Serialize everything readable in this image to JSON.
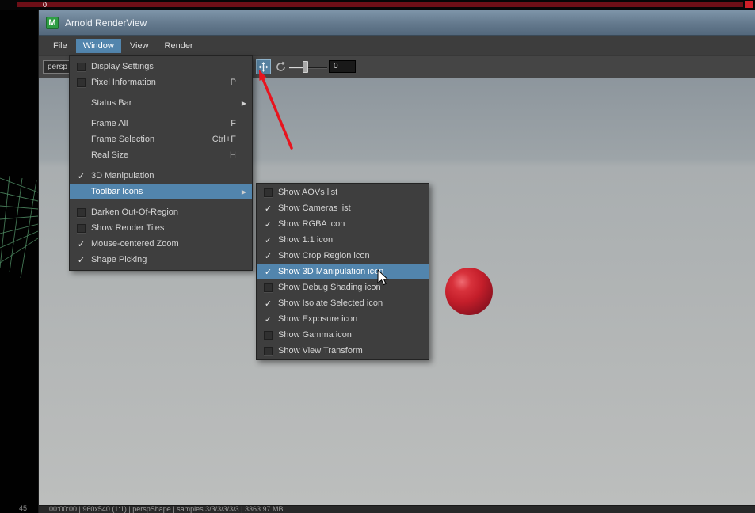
{
  "colors": {
    "highlight_blue": "#5285ad",
    "maya_green": "#2f9e44",
    "sphere_red": "#c41e2a",
    "annotation_red": "#e8141e"
  },
  "top_strip": {
    "frame_label": "0"
  },
  "left_panel": {
    "frame_number": "45"
  },
  "window": {
    "title": "Arnold RenderView",
    "badge": "M"
  },
  "menubar": {
    "items": [
      {
        "label": "File"
      },
      {
        "label": "Window",
        "active": true
      },
      {
        "label": "View"
      },
      {
        "label": "Render"
      }
    ]
  },
  "toolbar": {
    "camera": "persp",
    "exposure_value": "0"
  },
  "glyphs": {
    "check": "✓",
    "submenu_arrow": "▶"
  },
  "window_menu": {
    "items": [
      {
        "label": "Display Settings",
        "state": "unchecked"
      },
      {
        "label": "Pixel Information",
        "state": "unchecked",
        "shortcut": "P"
      },
      {
        "label": "Status Bar",
        "submenu": true
      },
      {
        "label": "Frame All",
        "shortcut": "F"
      },
      {
        "label": "Frame Selection",
        "shortcut": "Ctrl+F"
      },
      {
        "label": "Real Size",
        "shortcut": "H"
      },
      {
        "label": "3D Manipulation",
        "state": "checked"
      },
      {
        "label": "Toolbar Icons",
        "submenu": true,
        "highlighted": true
      },
      {
        "label": "Darken Out-Of-Region",
        "state": "unchecked"
      },
      {
        "label": "Show Render Tiles",
        "state": "unchecked"
      },
      {
        "label": "Mouse-centered Zoom",
        "state": "checked"
      },
      {
        "label": "Shape Picking",
        "state": "checked"
      }
    ]
  },
  "toolbar_icons_submenu": {
    "items": [
      {
        "label": "Show AOVs list",
        "state": "unchecked"
      },
      {
        "label": "Show Cameras list",
        "state": "checked"
      },
      {
        "label": "Show RGBA icon",
        "state": "checked"
      },
      {
        "label": "Show 1:1 icon",
        "state": "checked"
      },
      {
        "label": "Show Crop Region icon",
        "state": "checked"
      },
      {
        "label": "Show 3D Manipulation icon",
        "state": "checked",
        "highlighted": true
      },
      {
        "label": "Show Debug Shading icon",
        "state": "unchecked"
      },
      {
        "label": "Show Isolate Selected icon",
        "state": "checked"
      },
      {
        "label": "Show Exposure icon",
        "state": "checked"
      },
      {
        "label": "Show Gamma icon",
        "state": "unchecked"
      },
      {
        "label": "Show View Transform",
        "state": "unchecked"
      }
    ]
  },
  "statusbar": {
    "text": "00:00:00 | 960x540 (1:1) | perspShape | samples 3/3/3/3/3/3 | 3363.97 MB"
  }
}
